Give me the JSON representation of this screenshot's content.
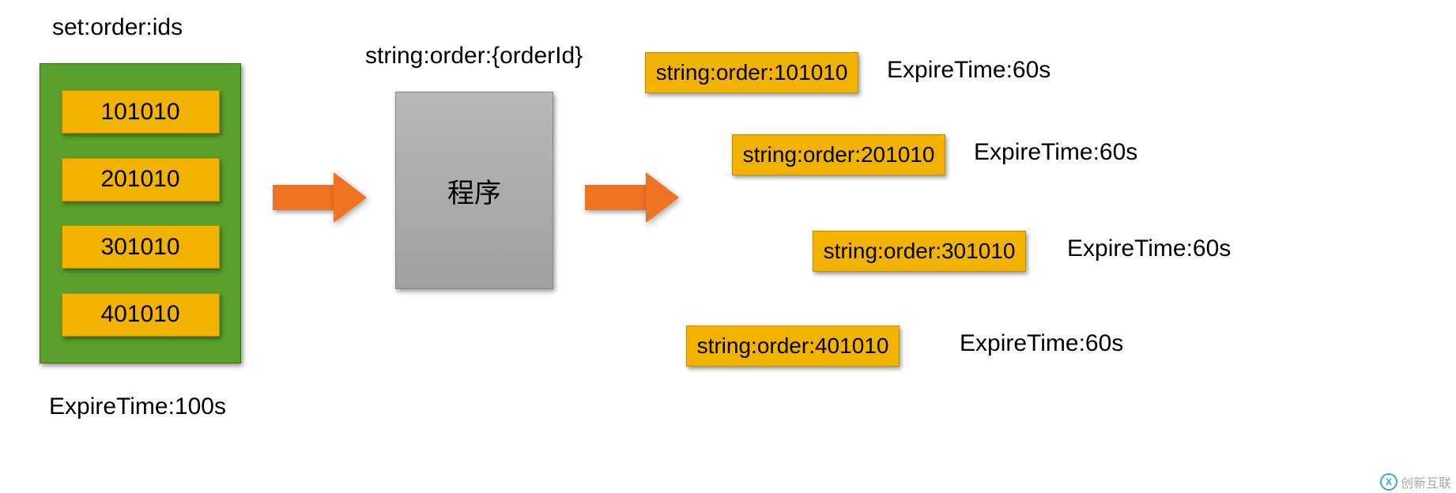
{
  "set_title": "set:order:ids",
  "set_items": [
    "101010",
    "201010",
    "301010",
    "401010"
  ],
  "set_expire": "ExpireTime:100s",
  "string_label": "string:order:{orderId}",
  "program_label": "程序",
  "order_rows": [
    {
      "key": "string:order:101010",
      "expire": "ExpireTime:60s"
    },
    {
      "key": "string:order:201010",
      "expire": "ExpireTime:60s"
    },
    {
      "key": "string:order:301010",
      "expire": "ExpireTime:60s"
    },
    {
      "key": "string:order:401010",
      "expire": "ExpireTime:60s"
    }
  ],
  "watermark": "创新互联",
  "colors": {
    "green": "#5aa02c",
    "gold": "#f2b200",
    "orange": "#ee7424",
    "grey": "#a8a8a8"
  }
}
